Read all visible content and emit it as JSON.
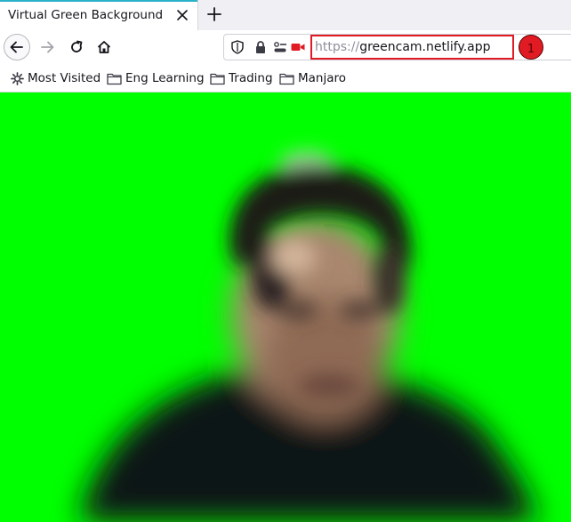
{
  "tab": {
    "title": "Virtual Green Background",
    "accent": "#2ab2c8"
  },
  "url": {
    "scheme": "https://",
    "host": "greencam.netlify.app"
  },
  "annotation": {
    "badge_number": "1",
    "color": "#e01b24"
  },
  "bookmarks": [
    {
      "label": "Most Visited",
      "icon": "gear-icon"
    },
    {
      "label": "Eng Learning",
      "icon": "folder-icon"
    },
    {
      "label": "Trading",
      "icon": "folder-icon"
    },
    {
      "label": "Manjaro",
      "icon": "folder-icon"
    }
  ],
  "content": {
    "background": "#00ff00"
  }
}
